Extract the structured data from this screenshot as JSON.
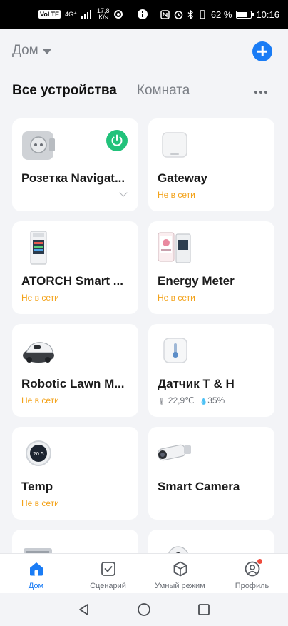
{
  "status_bar": {
    "volte": "VoLTE",
    "network": "4G⁺",
    "speed_value": "17,8",
    "speed_unit": "K/s",
    "battery_percent": "62 %",
    "battery_level": 0.62,
    "time": "10:16"
  },
  "header": {
    "home_name": "Дом",
    "tabs": [
      {
        "label": "Все устройства",
        "active": true
      },
      {
        "label": "Комната",
        "active": false
      }
    ]
  },
  "devices": [
    {
      "name": "Розетка Navigat...",
      "icon": "smart-plug-icon",
      "power_on": true
    },
    {
      "name": "Gateway",
      "icon": "gateway-icon",
      "status": "Не в сети"
    },
    {
      "name": "ATORCH Smart ...",
      "icon": "din-meter-icon",
      "status": "Не в сети"
    },
    {
      "name": "Energy Meter",
      "icon": "energy-meter-icon",
      "status": "Не в сети"
    },
    {
      "name": "Robotic Lawn M...",
      "icon": "lawn-mower-icon",
      "status": "Не в сети"
    },
    {
      "name": "Датчик Т & Н",
      "icon": "thermometer-icon",
      "temperature": "22,9℃",
      "humidity": "35%"
    },
    {
      "name": "Temp",
      "icon": "thermostat-icon",
      "status": "Не в сети",
      "display_value": "20.5"
    },
    {
      "name": "Smart  Camera",
      "icon": "camera-icon"
    }
  ],
  "bottom_nav": [
    {
      "label": "Дом",
      "icon": "home-icon",
      "active": true
    },
    {
      "label": "Сценарий",
      "icon": "checkbox-icon",
      "active": false
    },
    {
      "label": "Умный режим",
      "icon": "cube-icon",
      "active": false
    },
    {
      "label": "Профиль",
      "icon": "profile-icon",
      "active": false
    }
  ],
  "colors": {
    "accent": "#1a7cf5",
    "offline": "#f3a219",
    "power_on": "#22c27b"
  }
}
